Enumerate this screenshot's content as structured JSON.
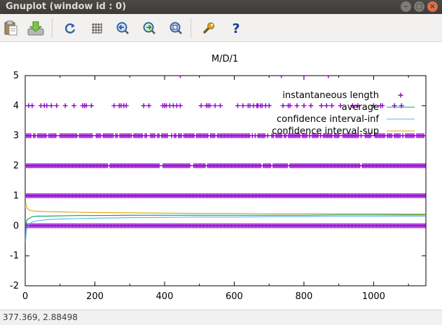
{
  "window": {
    "title": "Gnuplot (window id : 0)",
    "controls": [
      "minimize",
      "maximize",
      "close"
    ]
  },
  "toolbar": {
    "buttons": [
      {
        "name": "copy-to-clipboard",
        "icon": "clipboard-icon"
      },
      {
        "name": "export",
        "icon": "export-icon"
      },
      {
        "name": "replot",
        "icon": "replot-icon"
      },
      {
        "name": "toggle-grid",
        "icon": "grid-icon"
      },
      {
        "name": "previous-zoom",
        "icon": "zoom-previous-icon"
      },
      {
        "name": "next-zoom",
        "icon": "zoom-next-icon"
      },
      {
        "name": "autoscale",
        "icon": "autoscale-icon"
      },
      {
        "name": "settings",
        "icon": "wrench-icon"
      },
      {
        "name": "help",
        "icon": "help-icon"
      }
    ]
  },
  "status": {
    "coordinates": "377.369,  2.88498"
  },
  "chart_data": {
    "type": "scatter",
    "title": "M/D/1",
    "xlabel": "",
    "ylabel": "",
    "xlim": [
      0,
      1150
    ],
    "ylim": [
      -2,
      5
    ],
    "xticks": [
      "0",
      "200",
      "400",
      "600",
      "800",
      "1000"
    ],
    "yticks": [
      "-2",
      "-1",
      "0",
      "1",
      "2",
      "3",
      "4",
      "5"
    ],
    "grid": false,
    "legend_position": "top-right",
    "series": [
      {
        "name": "instantaneous length",
        "style": "points",
        "color": "#9400d3",
        "dense_levels": [
          0,
          1,
          2,
          3
        ],
        "level_gaps": {
          "2": [
            240,
            390,
            478,
            520,
            680,
            708,
            755,
            965
          ]
        },
        "level_3_density": 0.8,
        "level_4_x": [
          0,
          10,
          20,
          45,
          55,
          62,
          75,
          90,
          115,
          140,
          165,
          170,
          175,
          190,
          255,
          270,
          275,
          283,
          290,
          340,
          355,
          395,
          400,
          405,
          415,
          425,
          435,
          445,
          505,
          520,
          525,
          530,
          545,
          560,
          610,
          625,
          640,
          645,
          655,
          665,
          668,
          675,
          680,
          690,
          700,
          740,
          755,
          760,
          780,
          800,
          820,
          850,
          865,
          880,
          905,
          940,
          955,
          1000,
          1020,
          1025,
          1060,
          1080
        ],
        "level_5_x": [
          445,
          735,
          800,
          870
        ]
      },
      {
        "name": "average",
        "style": "line",
        "color": "#009e73",
        "x": [
          0,
          1,
          2,
          3,
          5,
          8,
          12,
          20,
          35,
          60,
          100,
          150,
          200,
          300,
          400,
          500,
          600,
          700,
          800,
          900,
          1000,
          1100,
          1150
        ],
        "values": [
          -0.5,
          -0.2,
          0.0,
          0.1,
          0.2,
          0.22,
          0.25,
          0.3,
          0.32,
          0.32,
          0.33,
          0.34,
          0.34,
          0.35,
          0.35,
          0.35,
          0.35,
          0.35,
          0.35,
          0.36,
          0.36,
          0.36,
          0.36
        ]
      },
      {
        "name": "confidence interval-inf",
        "style": "line",
        "color": "#56b4e9",
        "x": [
          0,
          1,
          2,
          3,
          5,
          8,
          12,
          20,
          35,
          60,
          100,
          150,
          200,
          300,
          400,
          500,
          600,
          700,
          800,
          900,
          1000,
          1100,
          1150
        ],
        "values": [
          -0.55,
          -0.5,
          -0.38,
          -0.22,
          -0.08,
          0.0,
          0.05,
          0.12,
          0.17,
          0.2,
          0.22,
          0.24,
          0.25,
          0.27,
          0.28,
          0.29,
          0.29,
          0.3,
          0.3,
          0.31,
          0.31,
          0.32,
          0.32
        ]
      },
      {
        "name": "confidence interval-sup",
        "style": "line",
        "color": "#e69f00",
        "x": [
          0,
          1,
          2,
          3,
          5,
          8,
          12,
          20,
          35,
          60,
          100,
          150,
          200,
          300,
          400,
          500,
          600,
          700,
          800,
          900,
          1000,
          1100,
          1150
        ],
        "values": [
          0.6,
          0.8,
          0.75,
          0.68,
          0.6,
          0.55,
          0.52,
          0.5,
          0.48,
          0.47,
          0.46,
          0.45,
          0.44,
          0.43,
          0.42,
          0.41,
          0.41,
          0.4,
          0.4,
          0.4,
          0.4,
          0.39,
          0.39
        ]
      }
    ]
  }
}
